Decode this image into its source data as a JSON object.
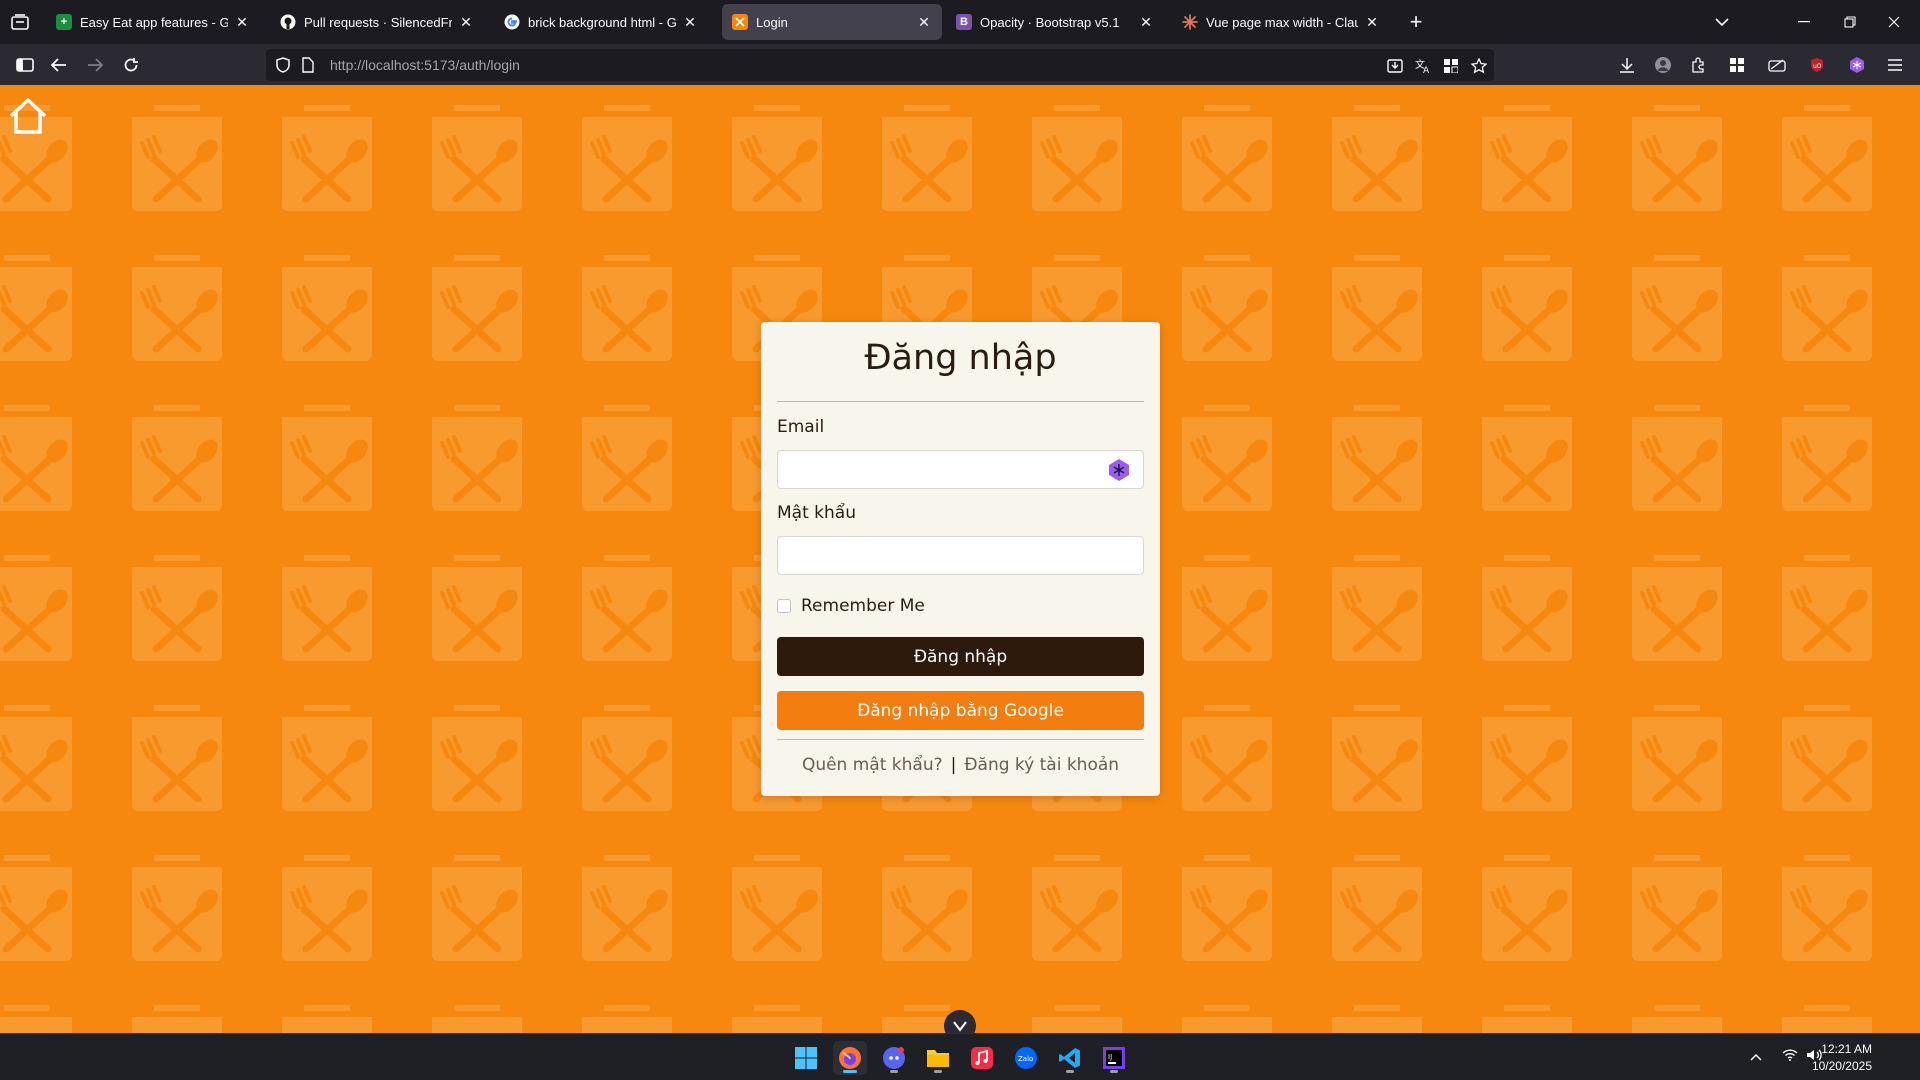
{
  "browser": {
    "tabs": [
      {
        "title": "Easy Eat app features - Google",
        "favicon_color": "#1e8e3e"
      },
      {
        "title": "Pull requests · SilencedFrost/AS",
        "favicon_color": "#24292f"
      },
      {
        "title": "brick background html - Googl",
        "favicon_color": "#ffffff"
      },
      {
        "title": "Login",
        "favicon_color": "#f7880f"
      },
      {
        "title": "Opacity · Bootstrap v5.1",
        "favicon_color": "#7952b3"
      },
      {
        "title": "Vue page max width - Claude",
        "favicon_color": "#d97757"
      }
    ],
    "url_host": "http://localhost",
    "url_path": ":5173/auth/login"
  },
  "login": {
    "title": "Đăng nhập",
    "email_label": "Email",
    "email_value": "",
    "password_label": "Mật khẩu",
    "password_value": "",
    "remember_label": "Remember Me",
    "submit_label": "Đăng nhập",
    "google_label": "Đăng nhập bằng Google",
    "forgot_label": "Quên mật khẩu?",
    "separator": "|",
    "register_label": "Đăng ký tài khoản"
  },
  "taskbar": {
    "time": "12:21 AM",
    "date": "10/20/2025"
  },
  "colors": {
    "page_background": "#f7880f",
    "pattern": "#f99a2f",
    "card_background": "#f8f5ec",
    "primary_button": "#2e1a0c",
    "google_button": "#f47d0f"
  }
}
